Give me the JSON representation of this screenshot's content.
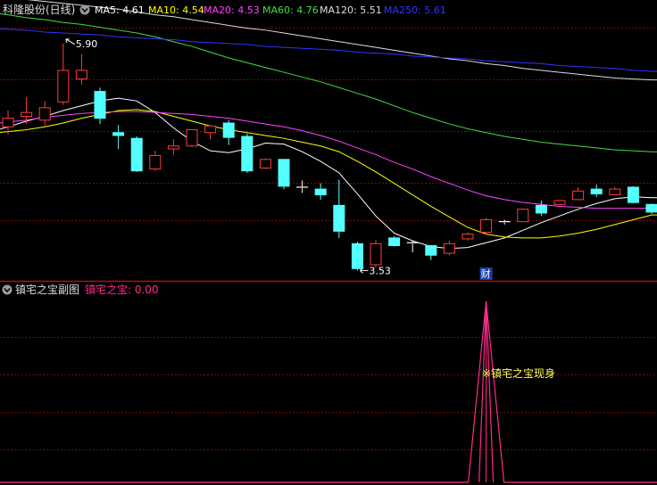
{
  "main_panel": {
    "title": "科隆股份(日线)",
    "indicators": [
      {
        "label": "MA5: 4.61",
        "color": "#ffffff"
      },
      {
        "label": "MA10: 4.54",
        "color": "#ffff00"
      },
      {
        "label": "MA20: 4.53",
        "color": "#ff44ff"
      },
      {
        "label": "MA60: 4.76",
        "color": "#44dd44"
      },
      {
        "label": "MA120: 5.51",
        "color": "#dddddd"
      },
      {
        "label": "MA250: 5.61",
        "color": "#3333ff"
      }
    ]
  },
  "sub_panel": {
    "title": "镇宅之宝副图",
    "indicator_label": "镇宅之宝: 0.00",
    "annotation": "※镇宅之宝现身"
  },
  "colors": {
    "up": "#ff3b3b",
    "down": "#54ffff",
    "grid": "#7a0a0a",
    "divider": "#b01010",
    "spike": "#ff2a8c",
    "annotation": "#ffff55"
  },
  "chart_data": [
    {
      "type": "candlestick",
      "ylim": [
        3.45,
        6.15
      ],
      "high_label": "5.90",
      "low_label": "3.53",
      "event_marker": "财",
      "event_index": 26,
      "candles": [
        {
          "o": 5.03,
          "h": 5.2,
          "l": 4.95,
          "c": 5.12
        },
        {
          "o": 5.14,
          "h": 5.34,
          "l": 5.06,
          "c": 5.18
        },
        {
          "o": 5.1,
          "h": 5.3,
          "l": 5.04,
          "c": 5.23
        },
        {
          "o": 5.29,
          "h": 5.9,
          "l": 5.26,
          "c": 5.62
        },
        {
          "o": 5.53,
          "h": 5.79,
          "l": 5.47,
          "c": 5.62
        },
        {
          "o": 5.4,
          "h": 5.44,
          "l": 5.06,
          "c": 5.12
        },
        {
          "o": 4.97,
          "h": 5.05,
          "l": 4.8,
          "c": 4.94
        },
        {
          "o": 4.91,
          "h": 4.93,
          "l": 4.56,
          "c": 4.57
        },
        {
          "o": 4.59,
          "h": 4.78,
          "l": 4.57,
          "c": 4.73
        },
        {
          "o": 4.8,
          "h": 4.9,
          "l": 4.74,
          "c": 4.83
        },
        {
          "o": 4.83,
          "h": 5.0,
          "l": 4.82,
          "c": 5.0
        },
        {
          "o": 4.97,
          "h": 5.05,
          "l": 4.9,
          "c": 5.04
        },
        {
          "o": 5.07,
          "h": 5.1,
          "l": 4.84,
          "c": 4.92
        },
        {
          "o": 4.93,
          "h": 4.96,
          "l": 4.55,
          "c": 4.57
        },
        {
          "o": 4.6,
          "h": 4.7,
          "l": 4.59,
          "c": 4.69
        },
        {
          "o": 4.69,
          "h": 4.69,
          "l": 4.38,
          "c": 4.41
        },
        {
          "o": 4.39,
          "h": 4.47,
          "l": 4.34,
          "c": 4.4
        },
        {
          "o": 4.38,
          "h": 4.44,
          "l": 4.27,
          "c": 4.32
        },
        {
          "o": 4.21,
          "h": 4.48,
          "l": 3.87,
          "c": 3.94
        },
        {
          "o": 3.81,
          "h": 3.83,
          "l": 3.53,
          "c": 3.55
        },
        {
          "o": 3.59,
          "h": 3.85,
          "l": 3.56,
          "c": 3.81
        },
        {
          "o": 3.87,
          "h": 3.89,
          "l": 3.78,
          "c": 3.79
        },
        {
          "o": 3.82,
          "h": 3.84,
          "l": 3.72,
          "c": 3.81
        },
        {
          "o": 3.79,
          "h": 3.79,
          "l": 3.64,
          "c": 3.69
        },
        {
          "o": 3.71,
          "h": 3.84,
          "l": 3.69,
          "c": 3.81
        },
        {
          "o": 3.86,
          "h": 3.93,
          "l": 3.84,
          "c": 3.91
        },
        {
          "o": 3.93,
          "h": 4.08,
          "l": 3.91,
          "c": 4.06
        },
        {
          "o": 4.03,
          "h": 4.06,
          "l": 4.01,
          "c": 4.04
        },
        {
          "o": 4.04,
          "h": 4.18,
          "l": 4.04,
          "c": 4.17
        },
        {
          "o": 4.21,
          "h": 4.26,
          "l": 4.1,
          "c": 4.13
        },
        {
          "o": 4.22,
          "h": 4.27,
          "l": 4.22,
          "c": 4.26
        },
        {
          "o": 4.27,
          "h": 4.4,
          "l": 4.27,
          "c": 4.36
        },
        {
          "o": 4.38,
          "h": 4.43,
          "l": 4.3,
          "c": 4.33
        },
        {
          "o": 4.32,
          "h": 4.4,
          "l": 4.32,
          "c": 4.38
        },
        {
          "o": 4.4,
          "h": 4.41,
          "l": 4.23,
          "c": 4.24
        },
        {
          "o": 4.22,
          "h": 4.23,
          "l": 4.12,
          "c": 4.14
        }
      ],
      "ma_lines": [
        {
          "name": "MA5",
          "color": "#ffffff",
          "values": [
            5.03,
            5.09,
            5.14,
            5.2,
            5.25,
            5.3,
            5.33,
            5.3,
            5.18,
            5.02,
            4.88,
            4.78,
            4.76,
            4.8,
            4.86,
            4.85,
            4.77,
            4.67,
            4.55,
            4.33,
            4.1,
            3.92,
            3.84,
            3.78,
            3.76,
            3.77,
            3.82,
            3.87,
            3.95,
            4.03,
            4.1,
            4.17,
            4.23,
            4.28,
            4.3,
            4.29
          ]
        },
        {
          "name": "MA10",
          "color": "#ffff00",
          "values": [
            4.98,
            5.0,
            5.03,
            5.07,
            5.12,
            5.16,
            5.2,
            5.21,
            5.19,
            5.14,
            5.09,
            5.04,
            5.0,
            4.97,
            4.94,
            4.91,
            4.87,
            4.83,
            4.77,
            4.67,
            4.56,
            4.44,
            4.32,
            4.2,
            4.09,
            3.98,
            3.91,
            3.88,
            3.87,
            3.87,
            3.89,
            3.92,
            3.96,
            4.01,
            4.06,
            4.11
          ]
        },
        {
          "name": "MA20",
          "color": "#ff44ff",
          "values": [
            5.08,
            5.1,
            5.13,
            5.15,
            5.17,
            5.18,
            5.19,
            5.19,
            5.18,
            5.17,
            5.16,
            5.14,
            5.12,
            5.09,
            5.06,
            5.03,
            4.99,
            4.94,
            4.88,
            4.81,
            4.74,
            4.66,
            4.59,
            4.51,
            4.44,
            4.37,
            4.31,
            4.27,
            4.24,
            4.22,
            4.2,
            4.19,
            4.18,
            4.18,
            4.18,
            4.18
          ]
        },
        {
          "name": "MA60",
          "color": "#44dd44",
          "values": [
            6.2,
            6.17,
            6.15,
            6.12,
            6.1,
            6.07,
            6.04,
            6.01,
            5.97,
            5.92,
            5.87,
            5.81,
            5.75,
            5.7,
            5.65,
            5.6,
            5.55,
            5.5,
            5.44,
            5.38,
            5.32,
            5.25,
            5.18,
            5.12,
            5.06,
            5.01,
            4.97,
            4.93,
            4.9,
            4.87,
            4.85,
            4.83,
            4.81,
            4.79,
            4.78,
            4.77
          ]
        },
        {
          "name": "MA120",
          "color": "#dddddd",
          "values": [
            6.38,
            6.36,
            6.34,
            6.32,
            6.3,
            6.28,
            6.26,
            6.23,
            6.2,
            6.18,
            6.15,
            6.12,
            6.09,
            6.06,
            6.04,
            6.01,
            5.98,
            5.95,
            5.92,
            5.89,
            5.86,
            5.83,
            5.8,
            5.77,
            5.74,
            5.72,
            5.69,
            5.67,
            5.64,
            5.62,
            5.6,
            5.58,
            5.56,
            5.54,
            5.53,
            5.52
          ]
        },
        {
          "name": "MA250",
          "color": "#3333ff",
          "values": [
            6.05,
            6.04,
            6.02,
            6.01,
            6.0,
            5.99,
            5.97,
            5.96,
            5.95,
            5.94,
            5.92,
            5.91,
            5.9,
            5.89,
            5.87,
            5.86,
            5.85,
            5.84,
            5.83,
            5.81,
            5.8,
            5.79,
            5.77,
            5.76,
            5.75,
            5.74,
            5.72,
            5.71,
            5.7,
            5.69,
            5.67,
            5.66,
            5.65,
            5.64,
            5.62,
            5.61
          ]
        }
      ]
    },
    {
      "type": "line",
      "series": [
        {
          "name": "镇宅之宝",
          "values": [
            0,
            0,
            0,
            0,
            0,
            0,
            0,
            0,
            0,
            0,
            0,
            0,
            0,
            0,
            0,
            0,
            0,
            0,
            0,
            0,
            0,
            0,
            0,
            0,
            0,
            0,
            1,
            0,
            0,
            0,
            0,
            0,
            0,
            0,
            0,
            0
          ]
        }
      ],
      "ylim": [
        0,
        1
      ]
    }
  ]
}
